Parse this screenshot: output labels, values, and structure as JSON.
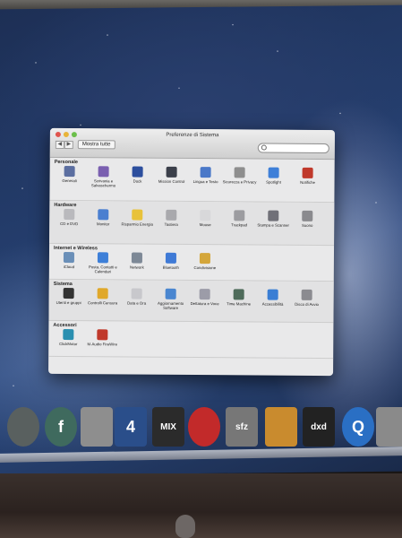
{
  "window": {
    "title": "Preferenze di Sistema",
    "show_all": "Mostra tutte",
    "back": "◀",
    "forward": "▶"
  },
  "sections": [
    {
      "title": "Personale",
      "items": [
        {
          "label": "Generali",
          "icon": "general-icon",
          "color": "#5b6ea0"
        },
        {
          "label": "Scrivania e Salvaschermo",
          "icon": "desktop-icon",
          "color": "#7a5fb0"
        },
        {
          "label": "Dock",
          "icon": "dock-icon",
          "color": "#2d4f9e"
        },
        {
          "label": "Mission Control",
          "icon": "mission-control-icon",
          "color": "#3b3f4a"
        },
        {
          "label": "Lingua e Testo",
          "icon": "language-icon",
          "color": "#4a78c8"
        },
        {
          "label": "Sicurezza e Privacy",
          "icon": "security-icon",
          "color": "#8e8e8e"
        },
        {
          "label": "Spotlight",
          "icon": "spotlight-icon",
          "color": "#3e7fd8"
        },
        {
          "label": "Notifiche",
          "icon": "notifications-icon",
          "color": "#c0392b"
        }
      ]
    },
    {
      "title": "Hardware",
      "items": [
        {
          "label": "CD e DVD",
          "icon": "cd-dvd-icon",
          "color": "#b9b9bd"
        },
        {
          "label": "Monitor",
          "icon": "monitor-icon",
          "color": "#4a7fd0"
        },
        {
          "label": "Risparmio Energia",
          "icon": "energy-icon",
          "color": "#e8c23a"
        },
        {
          "label": "Tastiera",
          "icon": "keyboard-icon",
          "color": "#a9a9ad"
        },
        {
          "label": "Mouse",
          "icon": "mouse-icon",
          "color": "#d8d8da"
        },
        {
          "label": "Trackpad",
          "icon": "trackpad-icon",
          "color": "#9c9ca0"
        },
        {
          "label": "Stampa e Scanner",
          "icon": "printer-icon",
          "color": "#707078"
        },
        {
          "label": "Suono",
          "icon": "sound-icon",
          "color": "#8a8a8e"
        }
      ]
    },
    {
      "title": "Internet e Wireless",
      "items": [
        {
          "label": "iCloud",
          "icon": "icloud-icon",
          "color": "#6a8fb8"
        },
        {
          "label": "Posta, Contatti e Calendari",
          "icon": "mail-contacts-icon",
          "color": "#3d7fd8"
        },
        {
          "label": "Network",
          "icon": "network-icon",
          "color": "#7d8896"
        },
        {
          "label": "Bluetooth",
          "icon": "bluetooth-icon",
          "color": "#3f7ad6"
        },
        {
          "label": "Condivisione",
          "icon": "sharing-icon",
          "color": "#d4a63a"
        }
      ]
    },
    {
      "title": "Sistema",
      "items": [
        {
          "label": "Utenti e gruppi",
          "icon": "users-icon",
          "color": "#333333"
        },
        {
          "label": "Controlli Censura",
          "icon": "parental-controls-icon",
          "color": "#e0a82a"
        },
        {
          "label": "Data e Ora",
          "icon": "date-time-icon",
          "color": "#c8c8cc"
        },
        {
          "label": "Aggiornamento Software",
          "icon": "software-update-icon",
          "color": "#4a86d0"
        },
        {
          "label": "Dettatura e Voce",
          "icon": "dictation-icon",
          "color": "#9c9ca8"
        },
        {
          "label": "Time Machine",
          "icon": "time-machine-icon",
          "color": "#4e6b5a"
        },
        {
          "label": "Accessibilità",
          "icon": "accessibility-icon",
          "color": "#3a7ed4"
        },
        {
          "label": "Disco di Avvio",
          "icon": "startup-disk-icon",
          "color": "#8b8b90"
        }
      ]
    },
    {
      "title": "Accessori",
      "items": [
        {
          "label": "ClickMotor",
          "icon": "clickmotor-icon",
          "color": "#2a8fb0"
        },
        {
          "label": "M-Audio FireWire",
          "icon": "m-audio-icon",
          "color": "#c0392b"
        }
      ]
    }
  ],
  "dock": [
    {
      "icon": "time-machine-dock-icon",
      "text": "",
      "color": "#59605f"
    },
    {
      "icon": "font-app-dock-icon",
      "text": "f",
      "color": "#3f6a5e"
    },
    {
      "icon": "utility-dock-icon",
      "text": "",
      "color": "#8e8e8e"
    },
    {
      "icon": "mp4-dock-icon",
      "text": "4",
      "color": "#2a4e8a"
    },
    {
      "icon": "mix-dock-icon",
      "text": "MIX",
      "color": "#2b2b2b"
    },
    {
      "icon": "knob-dock-icon",
      "text": "",
      "color": "#c22a2a"
    },
    {
      "icon": "sfz-dock-icon",
      "text": "sfz",
      "color": "#777777"
    },
    {
      "icon": "garageband-dock-icon",
      "text": "",
      "color": "#c98b2e"
    },
    {
      "icon": "dxd-dock-icon",
      "text": "dxd",
      "color": "#222222"
    },
    {
      "icon": "quicktime-dock-icon",
      "text": "Q",
      "color": "#2a6fc4"
    },
    {
      "icon": "prefs-dock-icon",
      "text": "",
      "color": "#8a8a8a"
    }
  ]
}
